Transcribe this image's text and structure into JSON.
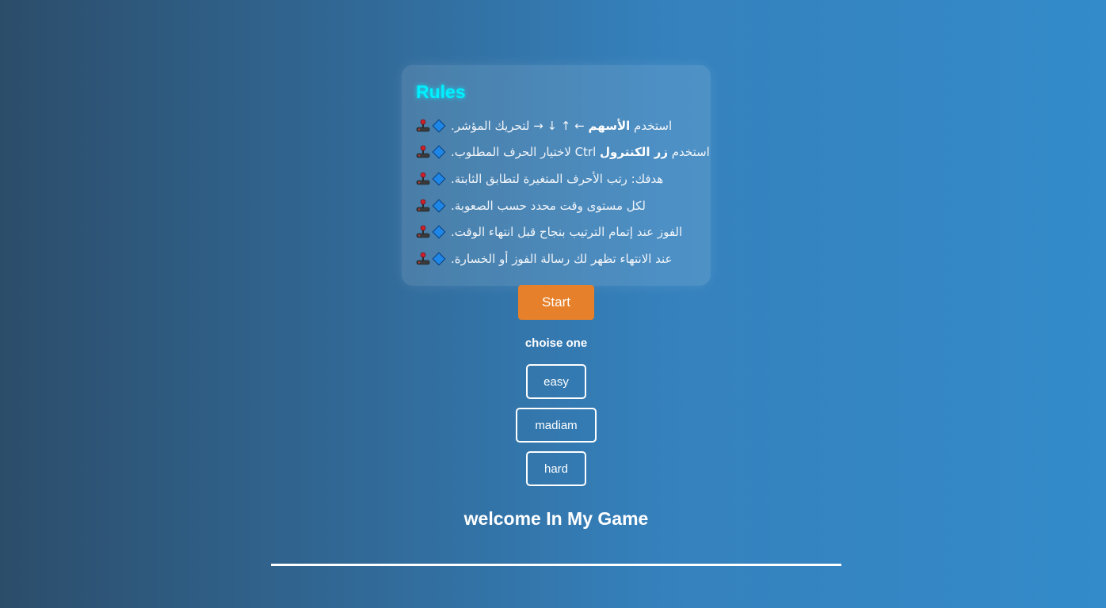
{
  "rules": {
    "title": "Rules",
    "items": [
      {
        "pre": "استخدم ",
        "bold": "الأسهم",
        "post": " ← ↑ ↓ → لتحريك المؤشر."
      },
      {
        "pre": "استخدم ",
        "bold": "زر الكنترول",
        "post": " Ctrl لاختيار الحرف المطلوب."
      },
      {
        "pre": "هدفك: رتب الأحرف المتغيرة لتطابق الثابتة.",
        "bold": "",
        "post": ""
      },
      {
        "pre": "لكل مستوى وقت محدد حسب الصعوبة.",
        "bold": "",
        "post": ""
      },
      {
        "pre": "الفوز عند إتمام الترتيب بنجاح قبل انتهاء الوقت.",
        "bold": "",
        "post": ""
      },
      {
        "pre": "عند الانتهاء تظهر لك رسالة الفوز أو الخسارة.",
        "bold": "",
        "post": ""
      }
    ],
    "icons": [
      "joystick-icon",
      "diamond-icon"
    ]
  },
  "start_button": {
    "label": "Start"
  },
  "levels": {
    "heading": "choise one",
    "options": [
      "easy",
      "madiam",
      "hard"
    ]
  },
  "welcome": {
    "title": "welcome In My Game"
  },
  "colors": {
    "title_glow": "#00f0ff",
    "start_button": "#e6802a",
    "background_start": "#2c4d6a",
    "background_end": "#338bc9"
  }
}
